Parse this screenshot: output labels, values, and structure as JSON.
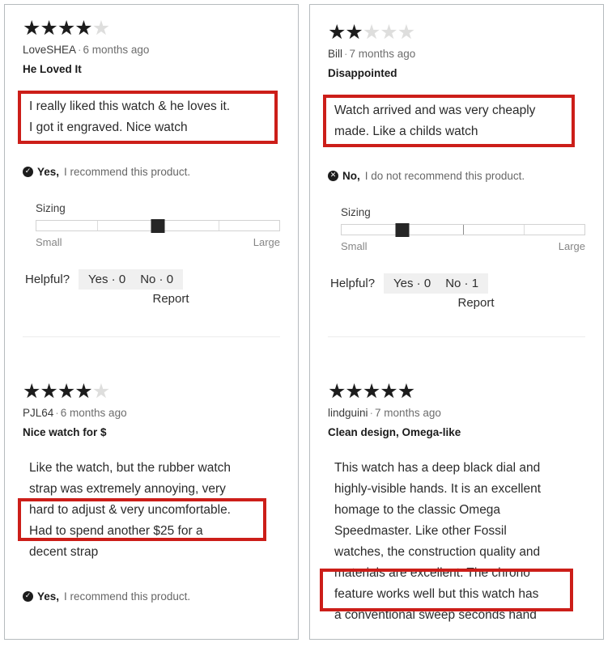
{
  "panels": [
    {
      "name": "left-column",
      "reviews": [
        {
          "rating": 4,
          "max_rating": 5,
          "author": "LoveSHEA",
          "separator": "·",
          "age": "6 months ago",
          "title": "He Loved It",
          "body_lines": [
            "I really liked this watch & he loves it.",
            "I got it engraved. Nice watch"
          ],
          "recommend": {
            "icon": "check-circle-icon",
            "glyph": "✓",
            "strong": "Yes",
            "comma": ",",
            "text": "I recommend this product."
          },
          "sizing": {
            "label": "Sizing",
            "small_label": "Small",
            "large_label": "Large",
            "value_percent": 50,
            "segments": 4
          },
          "helpful": {
            "label": "Helpful?",
            "yes": "Yes · 0",
            "no": "No · 0",
            "report": "Report"
          }
        },
        {
          "rating": 4,
          "max_rating": 5,
          "author": "PJL64",
          "separator": "·",
          "age": "6 months ago",
          "title": "Nice watch for $",
          "body_lines": [
            "Like the watch, but the rubber watch",
            "strap was extremely annoying, very",
            "hard to adjust & very uncomfortable.",
            "Had to spend another $25 for a",
            "decent strap"
          ],
          "recommend": {
            "icon": "check-circle-icon",
            "glyph": "✓",
            "strong": "Yes",
            "comma": ",",
            "text": "I recommend this product."
          }
        }
      ]
    },
    {
      "name": "right-column",
      "reviews": [
        {
          "rating": 2,
          "max_rating": 5,
          "author": "Bill",
          "separator": "·",
          "age": "7 months ago",
          "title": "Disappointed",
          "body_lines": [
            "Watch arrived and was very cheaply",
            "made. Like a childs watch"
          ],
          "recommend": {
            "icon": "x-circle-icon",
            "glyph": "✕",
            "strong": "No",
            "comma": ",",
            "text": "I do not recommend this product."
          },
          "sizing": {
            "label": "Sizing",
            "small_label": "Small",
            "large_label": "Large",
            "value_percent": 25,
            "segments": 4
          },
          "helpful": {
            "label": "Helpful?",
            "yes": "Yes · 0",
            "no": "No · 1",
            "report": "Report"
          }
        },
        {
          "rating": 5,
          "max_rating": 5,
          "author": "lindguini",
          "separator": "·",
          "age": "7 months ago",
          "title": "Clean design, Omega-like",
          "body_lines": [
            "This watch has a deep black dial and",
            "highly-visible hands. It is an excellent",
            "homage to the classic Omega",
            "Speedmaster. Like other Fossil",
            "watches, the construction quality and",
            "materials are excellent. The chrono",
            "feature works well but this watch has",
            "a conventional sweep seconds hand"
          ]
        }
      ]
    }
  ],
  "annotation": {
    "color": "#cc1e19",
    "boxes": [
      {
        "panel": 0,
        "review": 0,
        "from_line": 0,
        "to_line": 1
      },
      {
        "panel": 0,
        "review": 1,
        "from_line": 1,
        "to_line": 2
      },
      {
        "panel": 1,
        "review": 0,
        "from_line": 0,
        "to_line": 1
      },
      {
        "panel": 1,
        "review": 1,
        "from_line": 4,
        "to_line": 5
      }
    ]
  },
  "star_glyph": "★"
}
